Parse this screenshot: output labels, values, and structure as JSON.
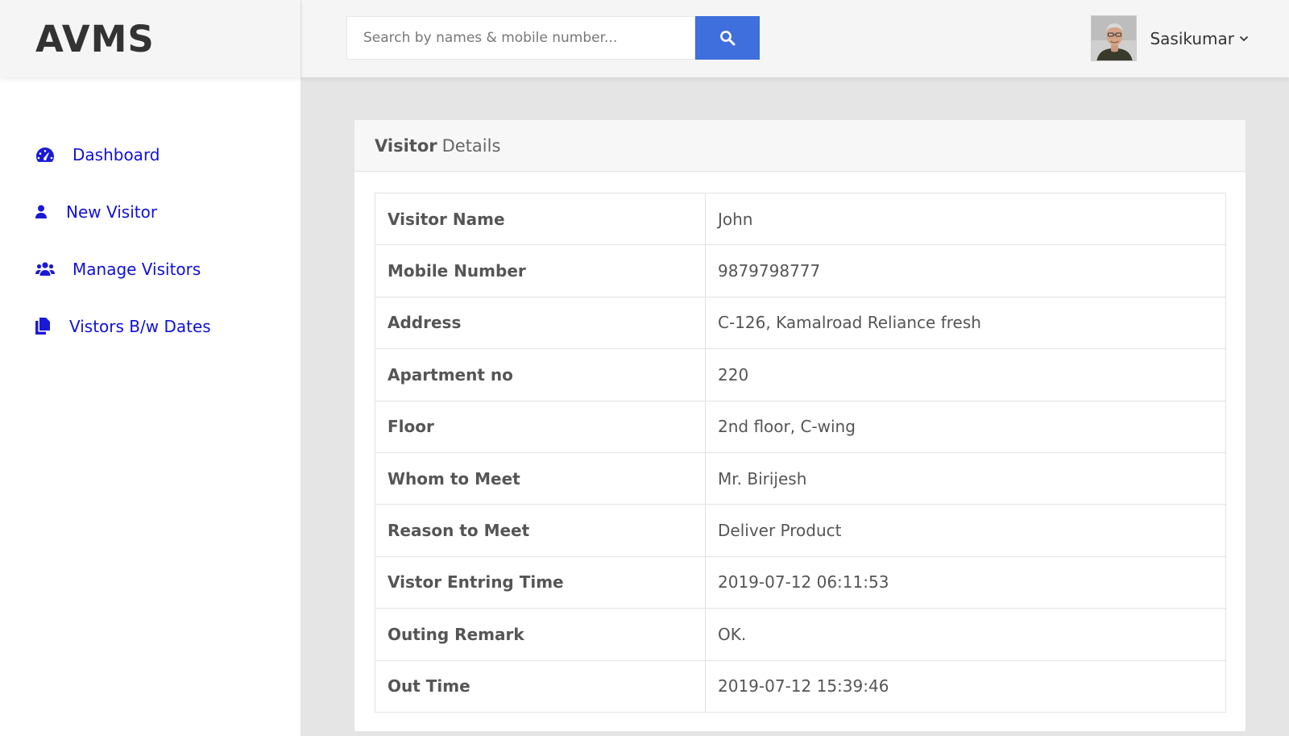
{
  "brand": {
    "title": "AVMS"
  },
  "sidebar": {
    "items": [
      {
        "label": "Dashboard",
        "icon": "dashboard-gauge-icon"
      },
      {
        "label": "New Visitor",
        "icon": "user-icon"
      },
      {
        "label": "Manage Visitors",
        "icon": "users-icon"
      },
      {
        "label": "Vistors B/w Dates",
        "icon": "files-icon"
      }
    ]
  },
  "header": {
    "search": {
      "placeholder": "Search by names & mobile number...",
      "value": ""
    },
    "user": {
      "name": "Sasikumar"
    }
  },
  "card": {
    "title_strong": "Visitor",
    "title_light": "Details",
    "rows": [
      {
        "label": "Visitor Name",
        "value": "John"
      },
      {
        "label": "Mobile Number",
        "value": "9879798777"
      },
      {
        "label": "Address",
        "value": "C-126, Kamalroad Reliance fresh"
      },
      {
        "label": "Apartment no",
        "value": "220"
      },
      {
        "label": "Floor",
        "value": "2nd floor, C-wing"
      },
      {
        "label": "Whom to Meet",
        "value": "Mr. Birijesh"
      },
      {
        "label": "Reason to Meet",
        "value": "Deliver Product"
      },
      {
        "label": "Vistor Entring Time",
        "value": "2019-07-12 06:11:53"
      },
      {
        "label": "Outing Remark",
        "value": "OK."
      },
      {
        "label": "Out Time",
        "value": "2019-07-12 15:39:46"
      }
    ]
  },
  "colors": {
    "accent": "#3f6fdc",
    "nav_link": "#1010d8",
    "background": "#e5e5e5"
  }
}
